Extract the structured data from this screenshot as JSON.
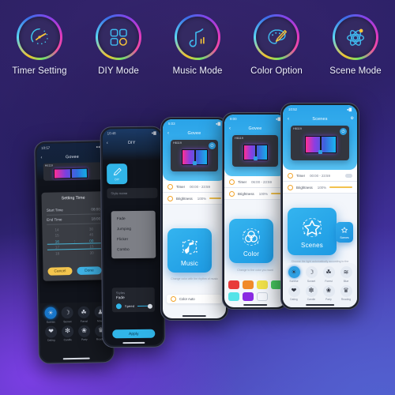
{
  "features": [
    {
      "id": "timer-setting",
      "label": "Timer Setting",
      "icon": "gauge-clock-icon"
    },
    {
      "id": "diy-mode",
      "label": "DIY Mode",
      "icon": "grid-squares-icon"
    },
    {
      "id": "music-mode",
      "label": "Music Mode",
      "icon": "music-note-icon"
    },
    {
      "id": "color-option",
      "label": "Color Option",
      "icon": "palette-icon"
    },
    {
      "id": "scene-mode",
      "label": "Scene Mode",
      "icon": "atom-icon"
    }
  ],
  "phone1": {
    "status_time": "10:57",
    "app_title": "Govee",
    "back_icon": "chevron-left-icon",
    "device_label": "H6119",
    "modal": {
      "title": "Setting Time",
      "start_label": "Start Time",
      "start_value": "08:00",
      "end_label": "End Time",
      "end_value": "18:00",
      "picker": {
        "hours": [
          "14",
          "15",
          "16",
          "17",
          "18"
        ],
        "separator": ":",
        "minutes": [
          "30",
          "45",
          "00",
          "15",
          "30"
        ],
        "selected_hour": "16",
        "selected_minute": "00"
      },
      "cancel_label": "Cancel",
      "done_label": "Done"
    },
    "scenes": [
      {
        "label": "Sunrise",
        "glyph": "☀",
        "active": true
      },
      {
        "label": "Sunset",
        "glyph": "☽",
        "active": false
      },
      {
        "label": "Forest",
        "glyph": "☘",
        "active": false
      },
      {
        "label": "Movie",
        "glyph": "♟",
        "active": false
      },
      {
        "label": "Dating",
        "glyph": "❤",
        "active": false
      },
      {
        "label": "Candle",
        "glyph": "❇",
        "active": false
      },
      {
        "label": "Party",
        "glyph": "❀",
        "active": false
      },
      {
        "label": "Reading",
        "glyph": "♛",
        "active": false
      }
    ]
  },
  "phone2": {
    "status_time": "10:48",
    "app_title": "DIY",
    "back_icon": "chevron-left-icon",
    "badge_label": "DIY",
    "badge_icon": "pencil-icon",
    "style_name_label": "Style name",
    "dropdown_options": [
      "Fade",
      "Jumping",
      "Flicker",
      "Combo"
    ],
    "styles_label": "Styles",
    "styles_value": "Fade",
    "speed_label": "Speed",
    "speed_icon": "speed-icon",
    "apply_label": "Apply"
  },
  "phone3": {
    "status_time": "5:03",
    "app_title": "Govee",
    "back_icon": "chevron-left-icon",
    "device_label": "H6119",
    "timer_label": "Timer",
    "timer_value": "00:00 - 23:59",
    "brightness_label": "Brightness",
    "brightness_value": "100%",
    "card_title": "Music",
    "card_icon": "music-note-circle-icon",
    "hint": "Change color with the rhythm of music",
    "auto_label": "Color Auto",
    "auto_icon": "color-auto-icon"
  },
  "phone4": {
    "status_time": "9:00",
    "app_title": "Govee",
    "back_icon": "chevron-left-icon",
    "device_label": "H6119",
    "timer_label": "Timer",
    "timer_value": "06:00 - 23:59",
    "brightness_label": "Brightness",
    "brightness_value": "100%",
    "card_title": "Color",
    "card_icon": "three-circles-icon",
    "hint": "Change to the color you want",
    "swatches": [
      "#e83b3b",
      "#f08a2a",
      "#f0e04a",
      "#47c95f",
      "#55e3e8",
      "#8a2be2",
      "#ffffff"
    ]
  },
  "phone5": {
    "status_time": "10:52",
    "app_title": "Scenes",
    "back_icon": "chevron-left-icon",
    "device_label": "H6119",
    "gear_icon": "gear-icon",
    "timer_label": "Timer",
    "timer_value": "00:00 - 23:59",
    "brightness_label": "Brightness",
    "brightness_value": "100%",
    "card_title": "Scenes",
    "card_icon": "star-circle-icon",
    "mini_title": "Scenes",
    "hint": "Choose the light automatically according to the scene",
    "scenes": [
      {
        "label": "Sunrise",
        "glyph": "☀",
        "active": true
      },
      {
        "label": "Sunset",
        "glyph": "☽",
        "active": false
      },
      {
        "label": "Forest",
        "glyph": "☘",
        "active": false
      },
      {
        "label": "Blue",
        "glyph": "≋",
        "active": false
      },
      {
        "label": "Dating",
        "glyph": "❤",
        "active": false
      },
      {
        "label": "Candle",
        "glyph": "❇",
        "active": false
      },
      {
        "label": "Party",
        "glyph": "❀",
        "active": false
      },
      {
        "label": "Reading",
        "glyph": "♛",
        "active": false
      }
    ]
  },
  "colors": {
    "accent_blue": "#31b5e8",
    "accent_yellow": "#f3c54e",
    "bg_purple": "#2c2063",
    "bg_violet": "#7b3fe4"
  }
}
